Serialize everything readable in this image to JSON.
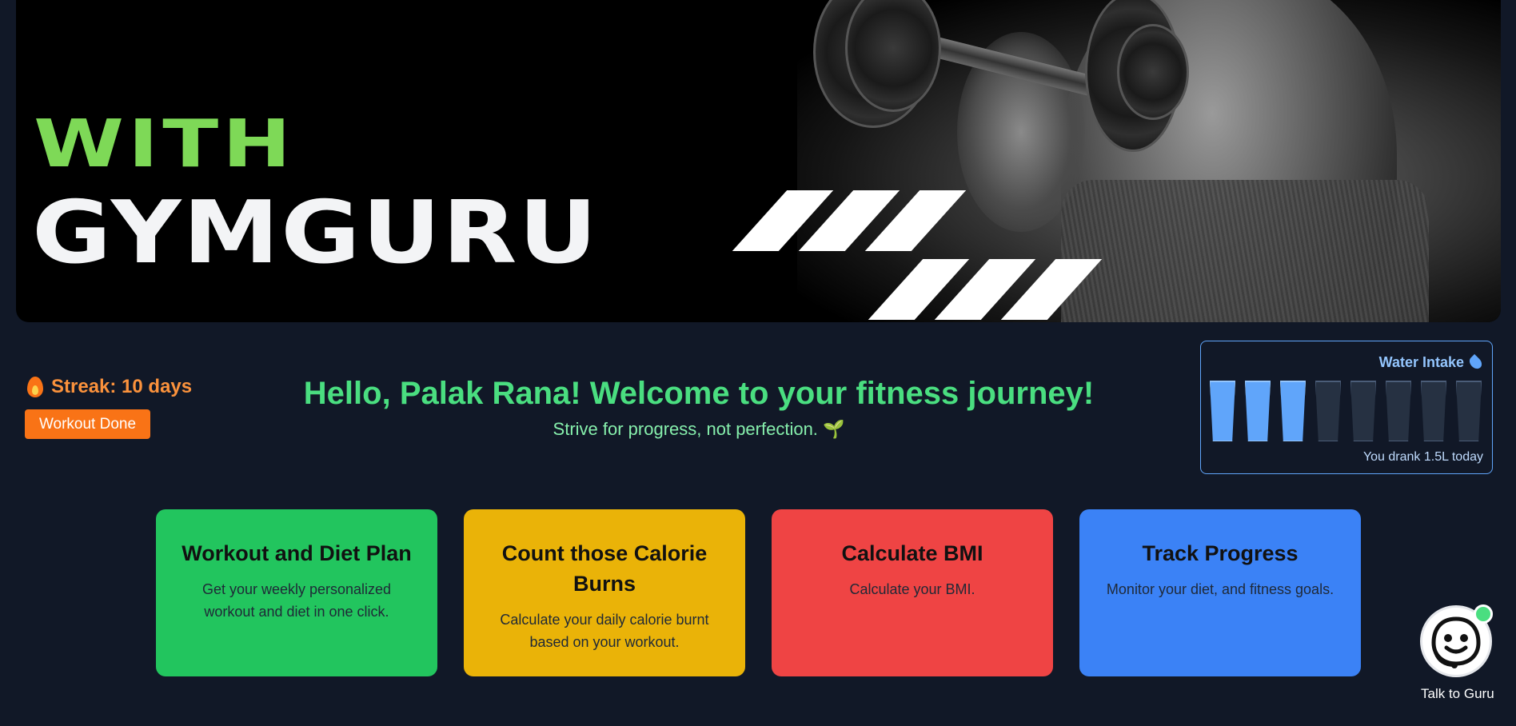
{
  "hero": {
    "line1": "WITH",
    "brand": "GYMGURU"
  },
  "streak": {
    "icon": "flame-icon",
    "label": "Streak: 10 days",
    "button": "Workout Done"
  },
  "greeting": {
    "title": "Hello, Palak Rana! Welcome to your fitness journey!",
    "motto": "Strive for progress, not perfection. 🌱"
  },
  "water": {
    "title": "Water Intake",
    "icon": "water-drop-icon",
    "glasses_total": 8,
    "glasses_filled": 3,
    "status": "You drank 1.5L today"
  },
  "cards": [
    {
      "title": "Workout and Diet Plan",
      "description": "Get your weekly personalized workout and diet in one click.",
      "color": "#22c55e"
    },
    {
      "title": "Count those Calorie Burns",
      "description": "Calculate your daily calorie burnt based on your workout.",
      "color": "#eab308"
    },
    {
      "title": "Calculate BMI",
      "description": "Calculate your BMI.",
      "color": "#ef4444"
    },
    {
      "title": "Track Progress",
      "description": "Monitor your diet, and fitness goals.",
      "color": "#3b82f6"
    }
  ],
  "chatbot": {
    "label": "Talk to Guru",
    "icon": "guru-bot-icon",
    "status_color": "#4ade80"
  },
  "colors": {
    "background": "#111827",
    "accent_green": "#4ade80",
    "accent_orange": "#f97316",
    "water_blue": "#60a5fa"
  }
}
